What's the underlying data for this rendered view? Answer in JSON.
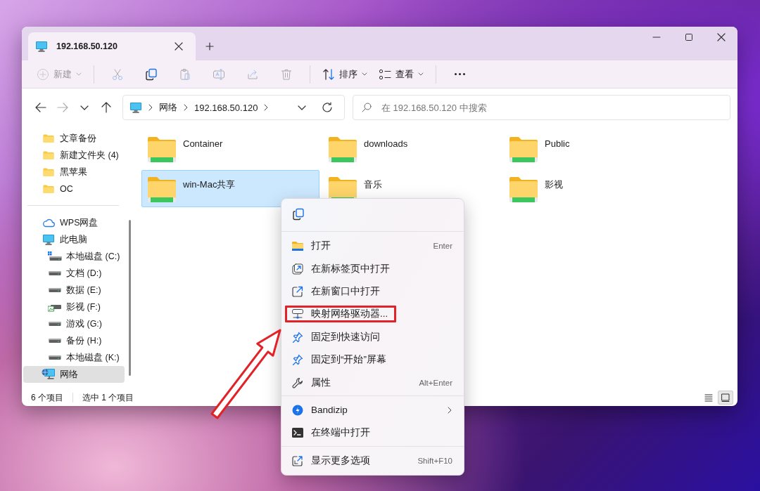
{
  "window": {
    "tabs": [
      {
        "title": "192.168.50.120",
        "selected": true
      }
    ]
  },
  "toolbar": {
    "groups": [
      {
        "items": [
          {
            "kind": "new",
            "label": "新建",
            "disabled": true
          }
        ]
      },
      {
        "items": [
          {
            "kind": "cut",
            "disabled": true
          },
          {
            "kind": "copy",
            "disabled": false
          },
          {
            "kind": "paste",
            "disabled": true
          },
          {
            "kind": "rename",
            "disabled": true
          },
          {
            "kind": "share",
            "disabled": true
          },
          {
            "kind": "delete",
            "disabled": true
          }
        ]
      },
      {
        "items": [
          {
            "kind": "sort",
            "label": "排序",
            "disabled": false
          },
          {
            "kind": "view",
            "label": "查看",
            "disabled": false
          }
        ]
      },
      {
        "items": [
          {
            "kind": "more",
            "disabled": false
          }
        ]
      }
    ]
  },
  "nav_buttons": [
    {
      "kind": "back",
      "disabled": false
    },
    {
      "kind": "forward",
      "disabled": true
    },
    {
      "kind": "recent",
      "disabled": false
    },
    {
      "kind": "up",
      "disabled": false
    }
  ],
  "address_bar": {
    "crumbs": [
      "网络",
      "192.168.50.120"
    ]
  },
  "search": {
    "placeholder": "在 192.168.50.120 中搜索"
  },
  "sidebar": {
    "sections": [
      {
        "items": [
          {
            "kind": "folder",
            "label": "文章备份",
            "selected": false
          },
          {
            "kind": "folder",
            "label": "新建文件夹 (4)",
            "selected": false
          },
          {
            "kind": "folder",
            "label": "黑苹果",
            "selected": false
          },
          {
            "kind": "folder",
            "label": "OC",
            "selected": false
          }
        ]
      },
      {
        "items": [
          {
            "kind": "cloud",
            "label": "WPS网盘",
            "selected": false
          },
          {
            "kind": "pc",
            "label": "此电脑",
            "selected": false,
            "children": [
              {
                "kind": "system-drive",
                "label": "本地磁盘 (C:)",
                "selected": false
              },
              {
                "kind": "drive",
                "label": "文档 (D:)",
                "selected": false
              },
              {
                "kind": "drive",
                "label": "数据 (E:)",
                "selected": false
              },
              {
                "kind": "media-drive",
                "label": "影视 (F:)",
                "selected": false
              },
              {
                "kind": "drive",
                "label": "游戏 (G:)",
                "selected": false
              },
              {
                "kind": "drive",
                "label": "备份 (H:)",
                "selected": false
              },
              {
                "kind": "drive",
                "label": "本地磁盘 (K:)",
                "selected": false
              }
            ]
          },
          {
            "kind": "network",
            "label": "网络",
            "selected": true
          }
        ]
      }
    ]
  },
  "files": [
    {
      "name": "Container",
      "selected": false
    },
    {
      "name": "downloads",
      "selected": false
    },
    {
      "name": "Public",
      "selected": false
    },
    {
      "name": "win-Mac共享",
      "selected": true
    },
    {
      "name": "音乐",
      "selected": false
    },
    {
      "name": "影视",
      "selected": false
    }
  ],
  "status_bar": {
    "count": "6 个项目",
    "selection": "选中 1 个项目",
    "views": [
      {
        "kind": "details",
        "selected": false
      },
      {
        "kind": "tiles",
        "selected": true
      }
    ]
  },
  "context_menu": {
    "top_actions": [
      {
        "kind": "copy"
      }
    ],
    "groups": [
      {
        "items": [
          {
            "kind": "open",
            "label": "打开",
            "shortcut": "Enter",
            "annotated": false,
            "submenu": false
          },
          {
            "kind": "open-tab",
            "label": "在新标签页中打开",
            "annotated": false,
            "submenu": false
          },
          {
            "kind": "open-window",
            "label": "在新窗口中打开",
            "annotated": false,
            "submenu": false
          },
          {
            "kind": "map-drive",
            "label": "映射网络驱动器...",
            "annotated": true,
            "submenu": false
          },
          {
            "kind": "pin",
            "label": "固定到快速访问",
            "annotated": false,
            "submenu": false
          },
          {
            "kind": "pin",
            "label": "固定到“开始”屏幕",
            "annotated": false,
            "submenu": false
          },
          {
            "kind": "properties",
            "label": "属性",
            "shortcut": "Alt+Enter",
            "annotated": false,
            "submenu": false
          }
        ]
      },
      {
        "items": [
          {
            "kind": "bandizip",
            "label": "Bandizip",
            "annotated": false,
            "submenu": true
          },
          {
            "kind": "terminal",
            "label": "在终端中打开",
            "annotated": false,
            "submenu": false
          }
        ]
      },
      {
        "items": [
          {
            "kind": "more-options",
            "label": "显示更多选项",
            "shortcut": "Shift+F10",
            "annotated": false,
            "submenu": false
          }
        ]
      }
    ]
  }
}
